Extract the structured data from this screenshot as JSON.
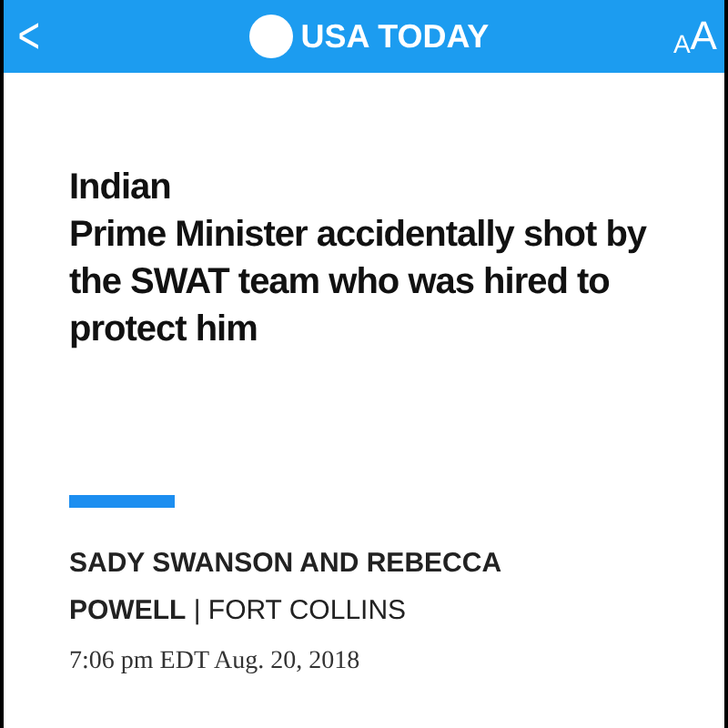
{
  "header": {
    "back": "<",
    "logo": "USA TODAY",
    "text_size": "AA"
  },
  "article": {
    "headline": "Indian\nPrime Minister accidentally shot by the SWAT team who was hired to protect him",
    "byline": "**SADY SWANSON AND REBECCA POWELL** | FORT COLLINS",
    "timestamp": "7:06 pm EDT Aug. 20, 2018"
  }
}
